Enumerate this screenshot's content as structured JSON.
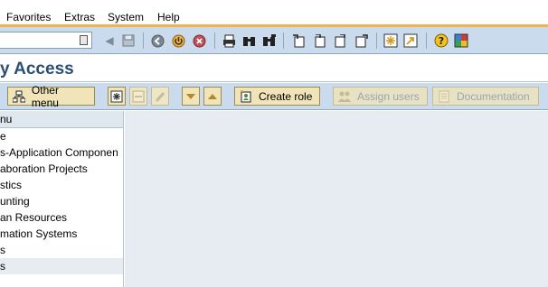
{
  "menubar": {
    "items": [
      "Favorites",
      "Extras",
      "System",
      "Help"
    ]
  },
  "toolbar": {
    "command_field_value": "",
    "icons": [
      "back-nav-icon",
      "save-icon",
      "back-icon",
      "exit-icon",
      "cancel-icon",
      "print-icon",
      "find-icon",
      "find-next-icon",
      "first-page-icon",
      "previous-page-icon",
      "next-page-icon",
      "last-page-icon",
      "create-session-icon",
      "shortcut-icon",
      "help-icon",
      "layout-icon"
    ]
  },
  "title": "y Access",
  "app_toolbar": {
    "other_menu": "Other menu",
    "create_role": "Create role",
    "assign_users": "Assign users",
    "documentation": "Documentation"
  },
  "tree": {
    "header": "nu",
    "items": [
      "e",
      "s-Application Componen",
      "aboration Projects",
      "stics",
      "unting",
      "an Resources",
      "mation Systems",
      "s",
      "s"
    ]
  },
  "colors": {
    "toolbar_bg": "#c9dbec",
    "menubar_accent": "#f3b250",
    "title_color": "#2b4f74",
    "button_bg": "#f0e4b8"
  }
}
